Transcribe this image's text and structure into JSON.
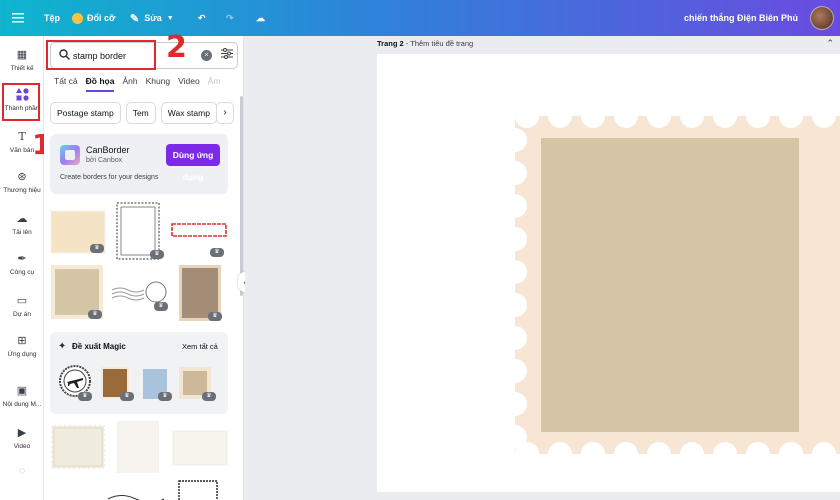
{
  "topbar": {
    "menu_icon": "hamburger-menu-icon",
    "file_label": "Tệp",
    "resize_label": "Đổi cỡ",
    "edit_label": "Sửa",
    "doc_title": "chiến thắng Điện Biên Phủ"
  },
  "rail": {
    "items": [
      {
        "label": "Thiết kế",
        "icon": "layout-icon"
      },
      {
        "label": "Thành phần",
        "icon": "shapes-icon"
      },
      {
        "label": "Văn bản",
        "icon": "text-icon"
      },
      {
        "label": "Thương hiệu",
        "icon": "brand-icon"
      },
      {
        "label": "Tải lên",
        "icon": "cloud-upload-icon"
      },
      {
        "label": "Công cụ",
        "icon": "pen-icon"
      },
      {
        "label": "Dự án",
        "icon": "folder-icon"
      },
      {
        "label": "Ứng dụng",
        "icon": "apps-icon"
      },
      {
        "label": "Nội dung M...",
        "icon": "magic-media-icon"
      },
      {
        "label": "Video",
        "icon": "video-icon"
      }
    ]
  },
  "annotations": {
    "step1": "1",
    "step2": "2"
  },
  "search": {
    "value": "stamp border",
    "clear_symbol": "×"
  },
  "tabs": [
    "Tất cả",
    "Đồ họa",
    "Ảnh",
    "Khung",
    "Video",
    "Âm"
  ],
  "chips": [
    "Postage stamp",
    "Tem",
    "Wax stamp"
  ],
  "promo": {
    "name": "CanBorder",
    "by": "bởi Canbox",
    "button": "Dùng ứng dụng",
    "description": "Create borders for your designs"
  },
  "magic": {
    "title": "Đề xuất Magic",
    "see_all": "Xem tất cả"
  },
  "canvas": {
    "page_name": "Trang 2",
    "page_title_placeholder": "Thêm tiêu đề trang"
  },
  "colors": {
    "accent": "#7d2ae8",
    "stamp_border": "#f6e6d3",
    "stamp_inner": "#d3c5a5",
    "annotation": "#e0282e"
  }
}
